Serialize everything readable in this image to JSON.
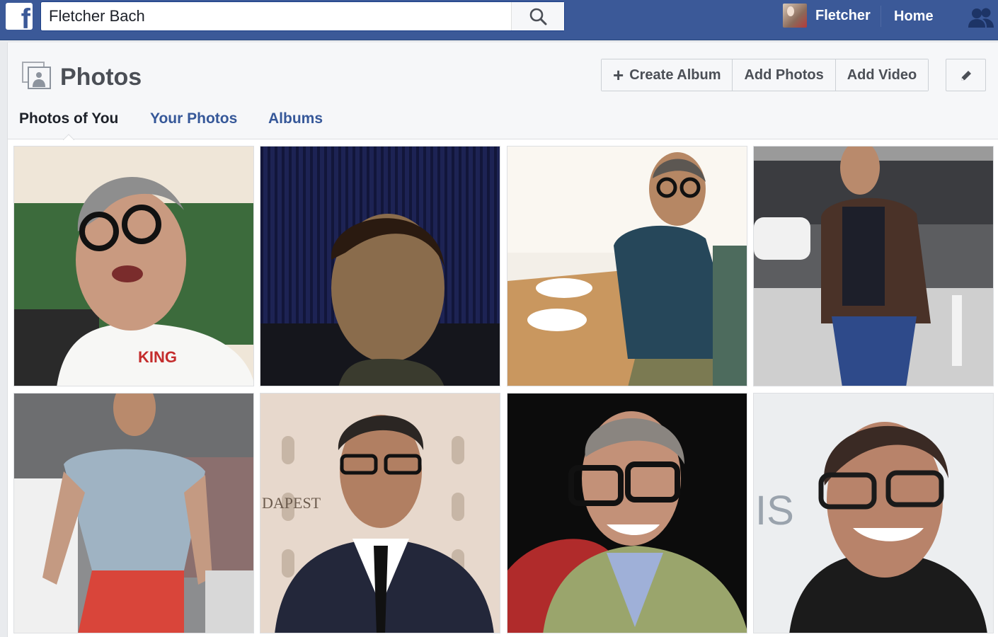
{
  "topbar": {
    "logo_glyph": "f",
    "search_value": "Fletcher Bach",
    "search_icon": "search-icon",
    "user_name": "Fletcher",
    "home_label": "Home",
    "friends_icon": "friend-requests-icon"
  },
  "header": {
    "title": "Photos",
    "buttons": {
      "create_album": "Create Album",
      "add_photos": "Add Photos",
      "add_video": "Add Video"
    }
  },
  "tabs": [
    {
      "label": "Photos of You",
      "active": true
    },
    {
      "label": "Your Photos",
      "active": false
    },
    {
      "label": "Albums",
      "active": false
    }
  ],
  "photos": [
    {
      "name": "photo-1",
      "palette": [
        "#efe6d8",
        "#3c6b3c",
        "#ffffff"
      ]
    },
    {
      "name": "photo-2",
      "palette": [
        "#1a1f4a",
        "#6b5140",
        "#2a2a30"
      ]
    },
    {
      "name": "photo-3",
      "palette": [
        "#f3efe8",
        "#28475a",
        "#c39a6b"
      ]
    },
    {
      "name": "photo-4",
      "palette": [
        "#5c5d60",
        "#4a3228",
        "#2e4a8a"
      ]
    },
    {
      "name": "photo-5",
      "palette": [
        "#8c8d8f",
        "#9fb3c3",
        "#d9453a"
      ]
    },
    {
      "name": "photo-6",
      "palette": [
        "#e7d8cc",
        "#23273a",
        "#ffffff"
      ]
    },
    {
      "name": "photo-7",
      "palette": [
        "#0c0c0c",
        "#b02b2b",
        "#9aa56c"
      ]
    },
    {
      "name": "photo-8",
      "palette": [
        "#eceef0",
        "#3a2a24",
        "#1b1b1b"
      ]
    }
  ],
  "photo_image_texts": {
    "photo_1_shirt": "KING",
    "photo_6_sign": "DAPEST",
    "photo_8_backdrop": "IS"
  },
  "colors": {
    "brand_blue": "#3b5998",
    "link_blue": "#365899",
    "text_dark": "#1d2129",
    "text_grey": "#4b4f56"
  }
}
